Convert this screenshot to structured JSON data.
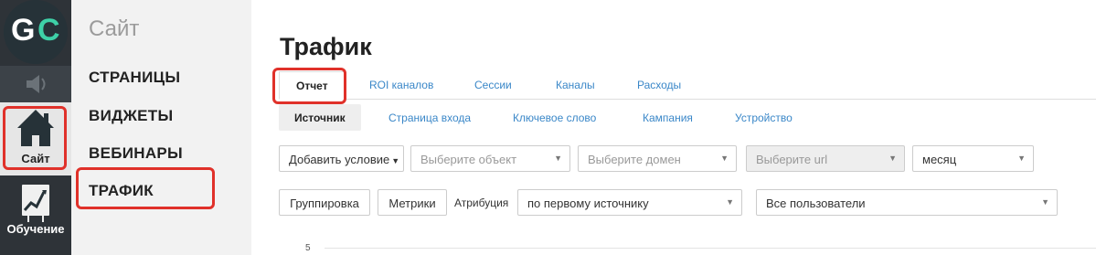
{
  "rail": {
    "logo_g": "G",
    "logo_c": "C",
    "items": [
      {
        "icon": "speaker-icon",
        "label": ""
      },
      {
        "icon": "home-icon",
        "label": "Сайт"
      },
      {
        "icon": "chart-board-icon",
        "label": "Обучение"
      }
    ]
  },
  "subnav": {
    "title": "Сайт",
    "items": [
      "СТРАНИЦЫ",
      "ВИДЖЕТЫ",
      "ВЕБИНАРЫ",
      "ТРАФИК"
    ]
  },
  "page": {
    "title": "Трафик"
  },
  "tabs_primary": [
    "Отчет",
    "ROI каналов",
    "Сессии",
    "Каналы",
    "Расходы"
  ],
  "tabs_secondary": [
    "Источник",
    "Страница входа",
    "Ключевое слово",
    "Кампания",
    "Устройство"
  ],
  "filters": {
    "add_condition": "Добавить условие",
    "object_placeholder": "Выберите объект",
    "domain_placeholder": "Выберите домен",
    "url_placeholder": "Выберите url",
    "period": "месяц"
  },
  "grouping": {
    "group_button": "Группировка",
    "metrics_button": "Метрики",
    "attribution_label": "Атрибуция",
    "attribution_value": "по первому источнику",
    "users_value": "Все пользователи"
  },
  "chart": {
    "y_tick": "5"
  },
  "colors": {
    "highlight": "#e0312a",
    "link": "#3a87c8",
    "brand_accent": "#3ed0a7"
  }
}
